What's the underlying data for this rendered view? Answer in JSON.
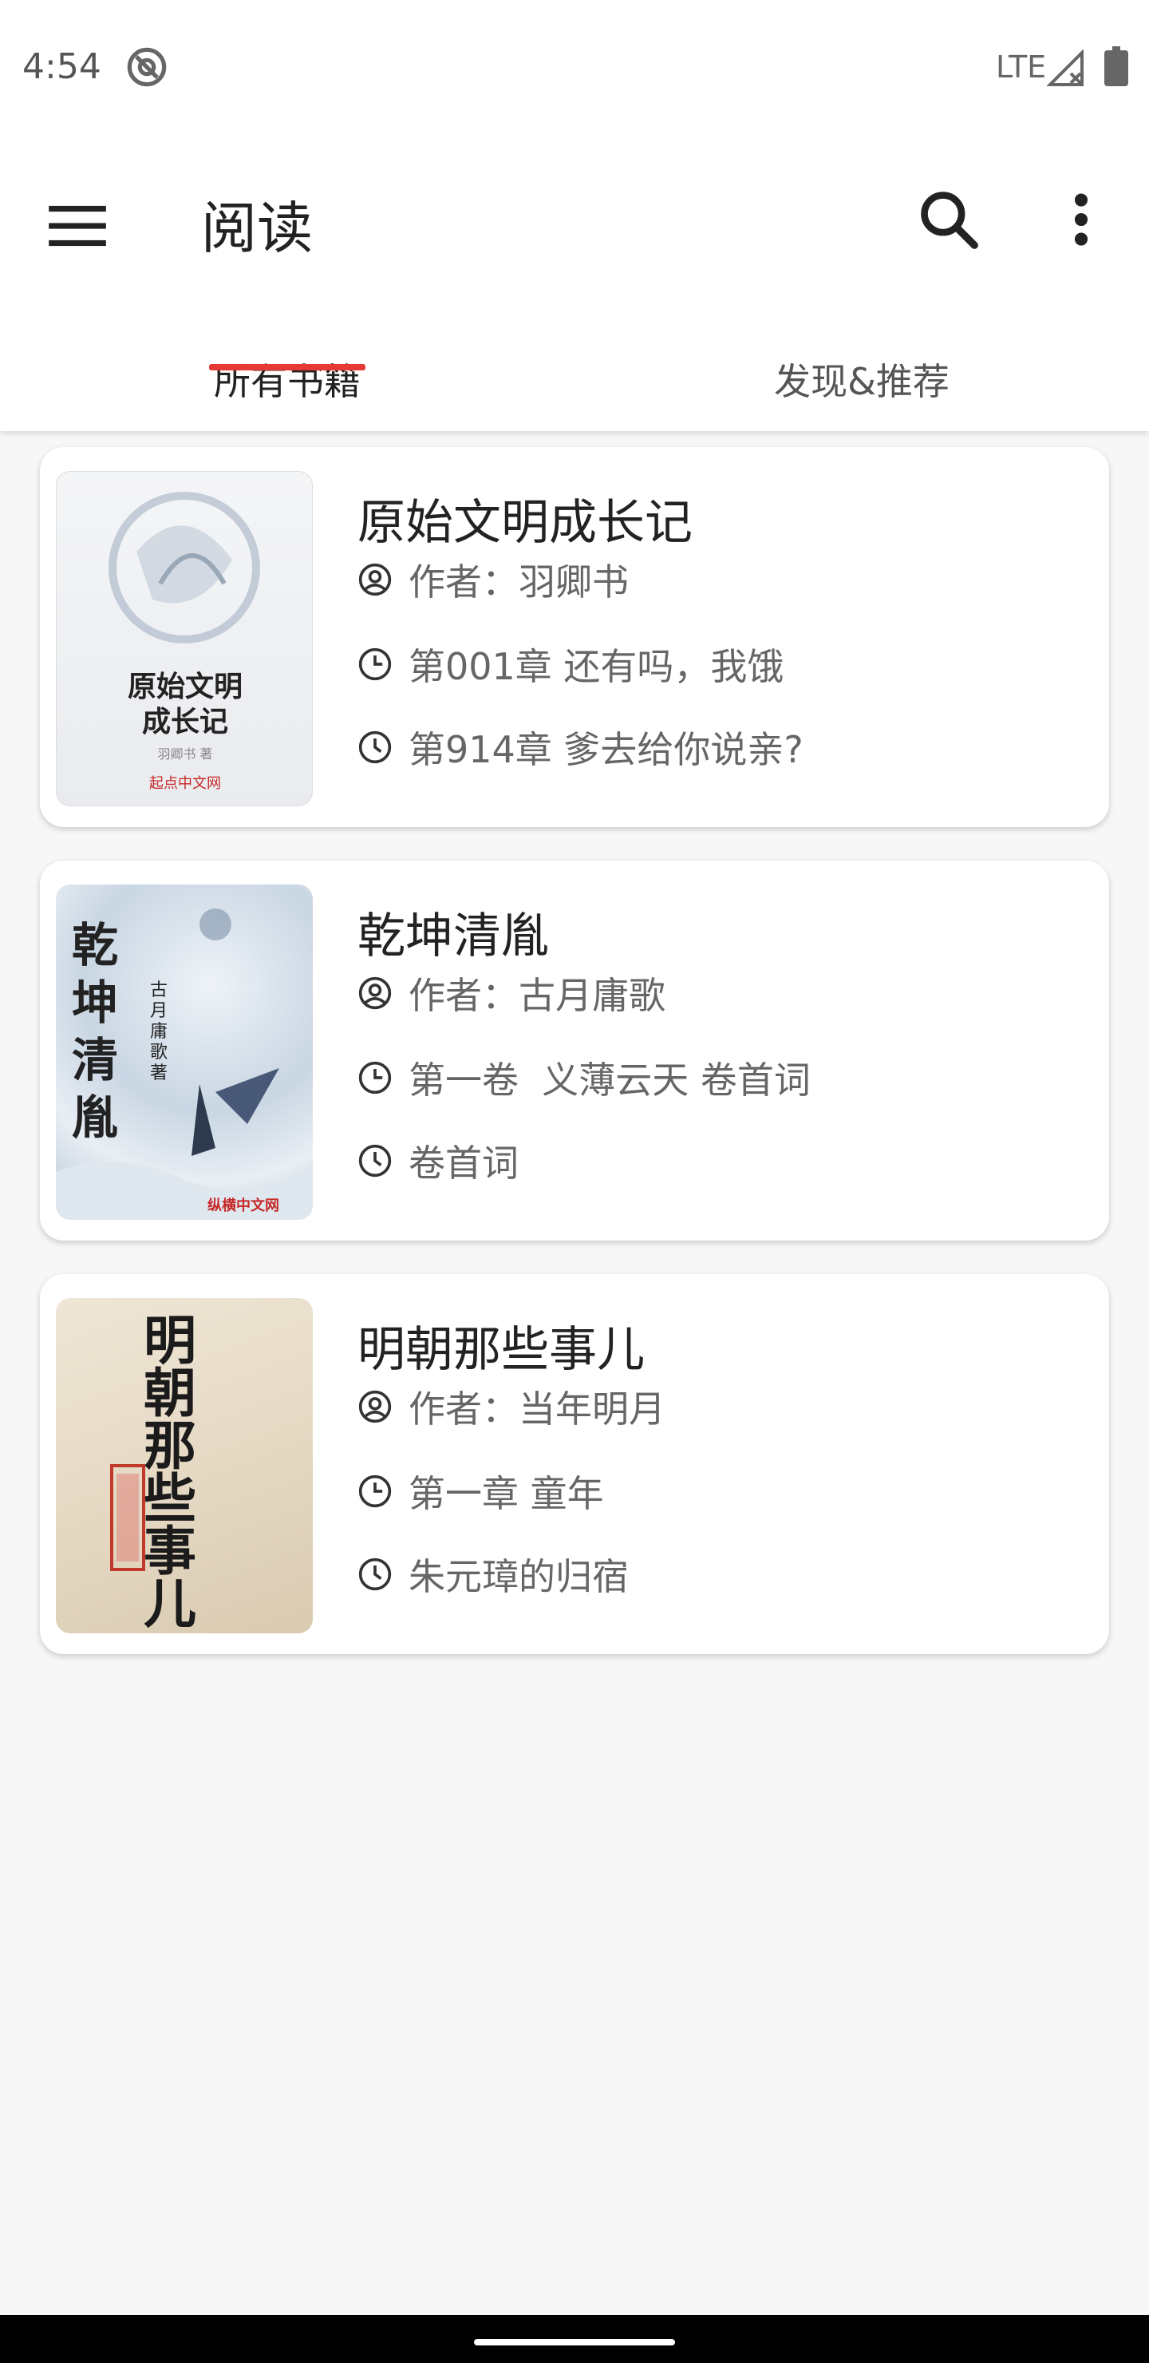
{
  "status_bar": {
    "time": "4:54",
    "network": "LTE",
    "icons": [
      "at-icon",
      "signal-icon",
      "battery-icon"
    ]
  },
  "app_bar": {
    "title": "阅读",
    "icons": [
      "menu-icon",
      "search-icon",
      "more-vert-icon"
    ],
    "accent_color": "#e53935"
  },
  "tabs": [
    {
      "label": "所有书籍",
      "selected": true
    },
    {
      "label": "发现&推荐",
      "selected": false
    }
  ],
  "books": [
    {
      "title": "原始文明成长记",
      "author_line": "作者：羽卿书",
      "chapter_line": "第001章 还有吗，我饿",
      "latest_line": "第914章 爹去给你说亲?",
      "cover": {
        "main_text": "原始文明",
        "sub_text": "成长记",
        "author_text": "羽卿书 著",
        "publisher_text": "起点中文网"
      }
    },
    {
      "title": "乾坤清胤",
      "author_line": "作者：古月庸歌",
      "chapter_line": "第一卷  义薄云天 卷首词",
      "latest_line": "卷首词",
      "cover": {
        "main_text": "乾坤清胤",
        "author_text": "古月庸歌 著",
        "publisher_text": "纵横中文网"
      }
    },
    {
      "title": "明朝那些事儿",
      "author_line": "作者：当年明月",
      "chapter_line": "第一章 童年",
      "latest_line": "朱元璋的归宿",
      "cover": {
        "main_text": "明朝那些事儿"
      }
    }
  ]
}
